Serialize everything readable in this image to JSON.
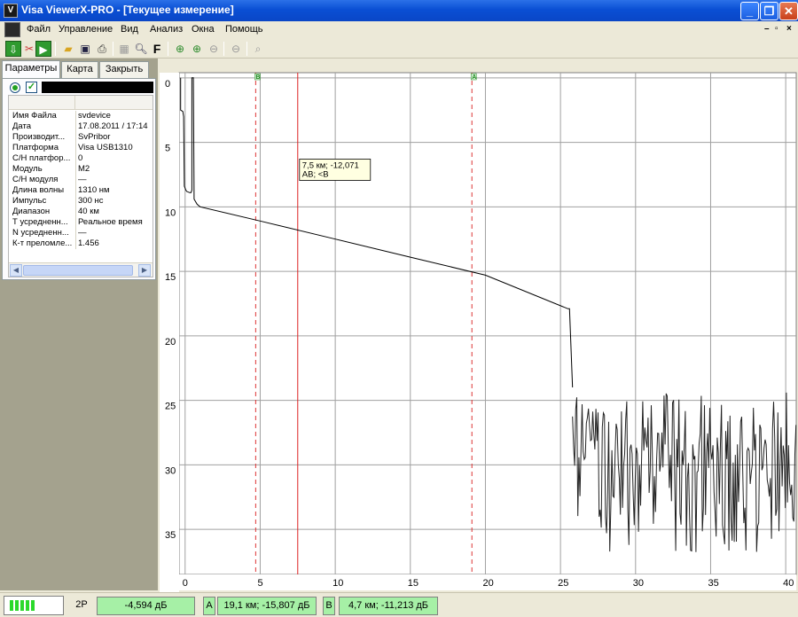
{
  "window": {
    "title": "Visa ViewerX-PRO - [Текущее измерение]",
    "app_icon_glyph": "V"
  },
  "menu": {
    "items": [
      "Файл",
      "Управление",
      "Вид",
      "Анализ",
      "Окна",
      "Помощь"
    ]
  },
  "left_panel": {
    "tabs": [
      "Параметры",
      "Карта",
      "Закрыть"
    ],
    "params": [
      {
        "key": "Имя Файла",
        "value": "svdevice"
      },
      {
        "key": "Дата",
        "value": "17.08.2011 / 17:14"
      },
      {
        "key": "Производит...",
        "value": "SvPribor"
      },
      {
        "key": "Платформа",
        "value": "Visa USB1310"
      },
      {
        "key": "С/Н платфор...",
        "value": "0"
      },
      {
        "key": "Модуль",
        "value": "M2"
      },
      {
        "key": "С/Н модуля",
        "value": "—"
      },
      {
        "key": "Длина волны",
        "value": "1310 нм"
      },
      {
        "key": "Импульс",
        "value": "300 нс"
      },
      {
        "key": "Диапазон",
        "value": "40 км"
      },
      {
        "key": "Т усредненн...",
        "value": "Реальное время"
      },
      {
        "key": "N усредненн...",
        "value": "—"
      },
      {
        "key": "К-т преломле...",
        "value": "1.456"
      }
    ]
  },
  "chart_data": {
    "type": "line",
    "x_axis": {
      "ticks": [
        0,
        5,
        10,
        15,
        20,
        25,
        30,
        35,
        40
      ],
      "range": [
        -0.4,
        40.7
      ]
    },
    "y_axis": {
      "ticks": [
        0,
        5,
        10,
        15,
        20,
        25,
        30,
        35
      ],
      "range": [
        -0.4,
        38.5
      ],
      "inverted": true
    },
    "grid": true,
    "trace_color": "#000000",
    "trace": {
      "x": [
        -0.3,
        -0.3,
        -0.15,
        -0.1,
        -0.05,
        0.05,
        0.1,
        0.3,
        0.4,
        0.45,
        0.45,
        0.55,
        0.6,
        0.8,
        1.0,
        5.0,
        10.0,
        15.0,
        20.0,
        25.5,
        25.6,
        25.8
      ],
      "y": [
        0.0,
        2.5,
        2.6,
        3.0,
        8.4,
        8.7,
        8.8,
        8.9,
        8.9,
        8.7,
        0.0,
        0.0,
        9.4,
        9.8,
        10.0,
        11.1,
        12.5,
        13.9,
        15.3,
        17.9,
        17.9,
        24.0
      ]
    },
    "noise_region": {
      "x_range": [
        25.8,
        40.7
      ],
      "y_range": [
        24.4,
        36.8
      ]
    },
    "markers": [
      {
        "label": "B",
        "x": 4.7,
        "color": "#dd3333",
        "style": "dashed",
        "tag_color": "#1a8a1a"
      },
      {
        "label": "A",
        "x": 19.1,
        "color": "#dd3333",
        "style": "dashed",
        "tag_color": "#1a8a1a"
      },
      {
        "label": "cursor",
        "x": 7.5,
        "color": "#dd2222",
        "style": "solid"
      }
    ],
    "tooltip": {
      "line1": "7,5 км; -12,071",
      "line2": "AB; <B"
    }
  },
  "status": {
    "mode": "2P",
    "value_2p": "-4,594 дБ",
    "label_a": "A",
    "value_a": "19,1 км; -15,807 дБ",
    "label_b": "B",
    "value_b": "4,7 км; -11,213 дБ",
    "battery_cells": 5
  },
  "colors": {
    "title_bar": "#0a4fd4",
    "status_green": "#a6f0a6",
    "marker_red": "#dd3333",
    "grid": "#a0a0a0"
  }
}
